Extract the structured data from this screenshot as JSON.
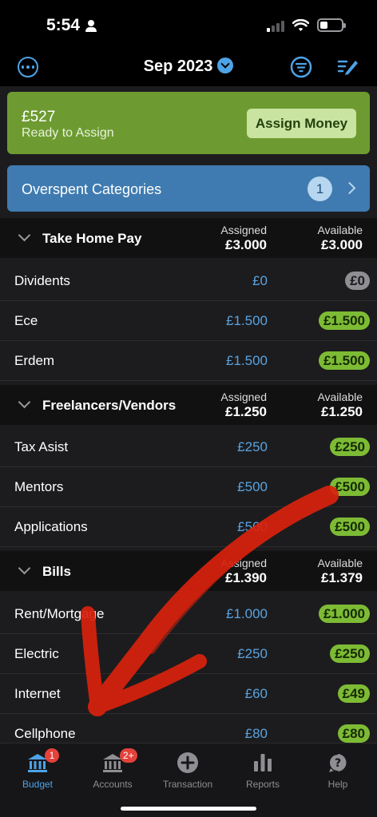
{
  "status_bar": {
    "time": "5:54"
  },
  "nav": {
    "month": "Sep 2023"
  },
  "ready_card": {
    "amount": "£527",
    "label": "Ready to Assign",
    "button": "Assign Money"
  },
  "overspent": {
    "label": "Overspent Categories",
    "count": "1"
  },
  "groups": [
    {
      "name": "Take Home Pay",
      "assigned_label": "Assigned",
      "assigned": "£3.000",
      "available_label": "Available",
      "available": "£3.000",
      "rows": [
        {
          "name": "Dividents",
          "assigned": "£0",
          "available": "£0"
        },
        {
          "name": "Ece",
          "assigned": "£1.500",
          "available": "£1.500"
        },
        {
          "name": "Erdem",
          "assigned": "£1.500",
          "available": "£1.500"
        }
      ]
    },
    {
      "name": "Freelancers/Vendors",
      "assigned_label": "Assigned",
      "assigned": "£1.250",
      "available_label": "Available",
      "available": "£1.250",
      "rows": [
        {
          "name": "Tax Asist",
          "assigned": "£250",
          "available": "£250"
        },
        {
          "name": "Mentors",
          "assigned": "£500",
          "available": "£500"
        },
        {
          "name": "Applications",
          "assigned": "£500",
          "available": "£500"
        }
      ]
    },
    {
      "name": "Bills",
      "assigned_label": "Assigned",
      "assigned": "£1.390",
      "available_label": "Available",
      "available": "£1.379",
      "rows": [
        {
          "name": "Rent/Mortgage",
          "assigned": "£1.000",
          "available": "£1.000"
        },
        {
          "name": "Electric",
          "assigned": "£250",
          "available": "£250"
        },
        {
          "name": "Internet",
          "assigned": "£60",
          "available": "£49"
        },
        {
          "name": "Cellphone",
          "assigned": "£80",
          "available": "£80"
        }
      ]
    }
  ],
  "tabs": [
    {
      "label": "Budget",
      "icon": "bank-icon",
      "badge": "1"
    },
    {
      "label": "Accounts",
      "icon": "bank-icon",
      "badge": "2+"
    },
    {
      "label": "Transaction",
      "icon": "plus-circle-icon"
    },
    {
      "label": "Reports",
      "icon": "bar-chart-icon"
    },
    {
      "label": "Help",
      "icon": "help-icon"
    }
  ],
  "colors": {
    "accent": "#4ea3e6",
    "ready_green": "#6d9b31",
    "overspent_blue": "#3f7bb0",
    "available_pill": "#7dbb35",
    "arrow_red": "#d9220d"
  }
}
